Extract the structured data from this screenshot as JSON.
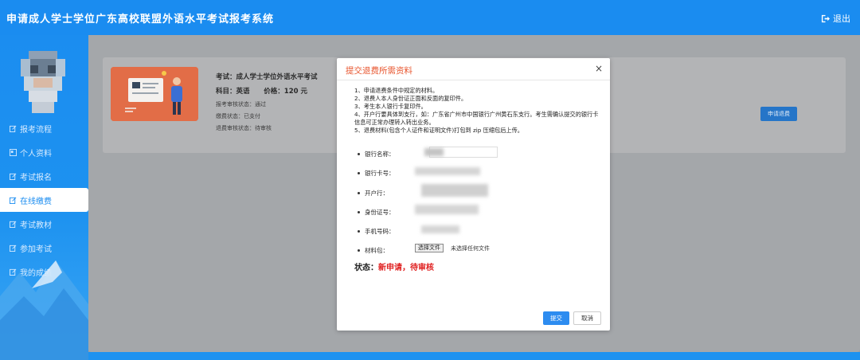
{
  "header": {
    "title": "申请成人学士学位广东高校联盟外语水平考试报考系统",
    "logout_label": "退出"
  },
  "sidebar": {
    "items": [
      {
        "label": "报考流程",
        "icon": "edit-icon",
        "active": false
      },
      {
        "label": "个人资料",
        "icon": "id-card-icon",
        "active": false
      },
      {
        "label": "考试报名",
        "icon": "edit-icon",
        "active": false
      },
      {
        "label": "在线缴费",
        "icon": "edit-icon",
        "active": true
      },
      {
        "label": "考试教材",
        "icon": "edit-icon",
        "active": false
      },
      {
        "label": "参加考试",
        "icon": "edit-icon",
        "active": false
      },
      {
        "label": "我的成绩",
        "icon": "edit-icon",
        "active": false
      }
    ]
  },
  "card": {
    "exam": "考试：成人学士学位外语水平考试",
    "subject": "科目：英语",
    "price": "价格：120 元",
    "review_status": "报考审核状态：通过",
    "pay_status": "缴费状态：已支付",
    "refund_status": "退费审核状态：待审核",
    "apply_label": "申请退费"
  },
  "modal": {
    "title": "提交退费所需资料",
    "close": "×",
    "notes": [
      "1、申请退费条件中规定的材料。",
      "2、退费人本人身份证正面和反面的复印件。",
      "3、考生本人银行卡复印件。",
      "4、开户行要具体到支行，如：广东省广州市中国银行广州黄石东支行。考生需确认提交的银行卡信息可正常办理转入转出业务。",
      "5、退费材料(包含个人证件和证明文件)打包到 zip 压缩包后上传。"
    ],
    "fields": [
      {
        "label": "银行名称：",
        "value": ""
      },
      {
        "label": "银行卡号：",
        "value": ""
      },
      {
        "label": "开户行：",
        "value": ""
      },
      {
        "label": "身份证号：",
        "value": ""
      },
      {
        "label": "手机号码：",
        "value": ""
      }
    ],
    "file_label": "材料包：",
    "file_button": "选择文件",
    "file_none": "未选择任何文件",
    "status_label": "状态：",
    "status_value": "新申请，待审核",
    "submit_label": "提交",
    "cancel_label": "取消"
  },
  "colors": {
    "brand": "#1a8cf0",
    "accent": "#e8562f",
    "status": "#e02020"
  }
}
